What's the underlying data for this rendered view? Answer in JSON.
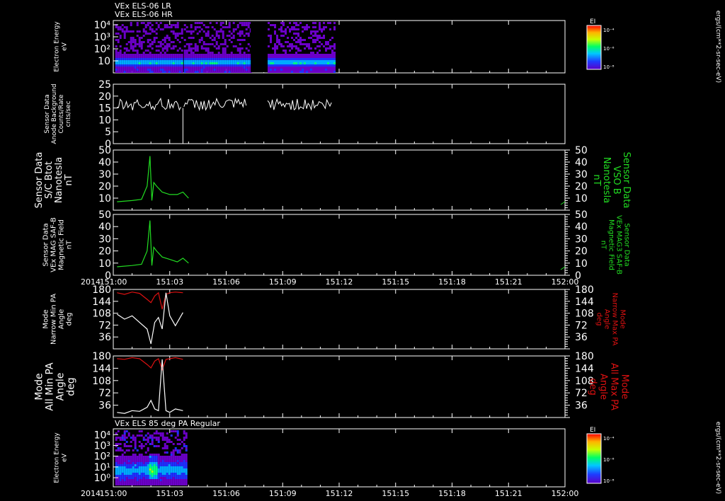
{
  "colors": {
    "background": "#000000",
    "foreground": "#ffffff",
    "green": "#22dd22",
    "red": "#dd1111"
  },
  "header": {
    "line1": "VEx ELS-06 LR",
    "line2": "VEx ELS-06 HR"
  },
  "chart_data": [
    {
      "type": "heatmap",
      "name": "panel-1",
      "ylabel": [
        "Electron Energy",
        "eV"
      ],
      "ylog": true,
      "yticks": [
        "10",
        "10²",
        "10³",
        "10⁴"
      ],
      "colorbar": {
        "title": "EI",
        "ticks": [
          "10⁻⁴",
          "10⁻⁶",
          "10⁻⁸"
        ],
        "unit_label": "ergs/(cm**2-sr-sec-eV)"
      },
      "data_segments": [
        [
          "151:00.1",
          "151:03.6"
        ],
        [
          "151:03.75",
          "151:07.3"
        ],
        [
          "151:08.2",
          "151:11.8"
        ]
      ],
      "gap": [
        "151:07.3",
        "151:08.2"
      ]
    },
    {
      "type": "line",
      "name": "panel-2",
      "ylabel": [
        "Sensor Data",
        "Anode Background",
        "Counts/Rate",
        "cnts/sec"
      ],
      "ylim": [
        0,
        25
      ],
      "yticks": [
        "0",
        "5",
        "10",
        "15",
        "20",
        "25"
      ],
      "series": [
        {
          "color": "#ffffff",
          "level_mean": 16.5,
          "spread": 2.5,
          "dropout_at": "151:03.7"
        }
      ]
    },
    {
      "type": "line",
      "name": "panel-3",
      "ylabel": [
        "Sensor Data",
        "S/C Btot",
        "Nanotesla",
        "nT"
      ],
      "ylabel_right": [
        "Sensor Data",
        "VSO B",
        "Nanotesla",
        "nT"
      ],
      "ylim": [
        0,
        50
      ],
      "yticks": [
        "10",
        "20",
        "30",
        "40",
        "50"
      ],
      "series": [
        {
          "color": "#22dd22",
          "x": [
            "151:00.2",
            "151:01.0",
            "151:01.5",
            "151:01.8",
            "151:01.95",
            "151:02.05",
            "151:02.15",
            "151:02.3",
            "151:02.6",
            "151:03.0",
            "151:03.4",
            "151:03.7",
            "151:04.0"
          ],
          "y": [
            7,
            8,
            9,
            20,
            45,
            8,
            23,
            20,
            15,
            13,
            13,
            15,
            10
          ]
        }
      ]
    },
    {
      "type": "line",
      "name": "panel-4",
      "ylabel": [
        "Sensor Data",
        "VEx MAG SAF-B",
        "Magnetic Field",
        "nT"
      ],
      "ylabel_right": [
        "Sensor Data",
        "VEx MAG3 SAF-B",
        "Magnetic Field",
        "nT"
      ],
      "ylim": [
        0,
        50
      ],
      "yticks": [
        "0",
        "10",
        "20",
        "30",
        "40",
        "50"
      ],
      "series": [
        {
          "color": "#22dd22",
          "x": [
            "151:00.2",
            "151:01.0",
            "151:01.5",
            "151:01.8",
            "151:01.95",
            "151:02.05",
            "151:02.15",
            "151:02.3",
            "151:02.6",
            "151:03.0",
            "151:03.4",
            "151:03.7",
            "151:04.0"
          ],
          "y": [
            7,
            8,
            9,
            20,
            45,
            8,
            23,
            20,
            15,
            13,
            11,
            14,
            10
          ]
        }
      ]
    },
    {
      "type": "line",
      "name": "panel-5",
      "ylabel": [
        "Mode",
        "Narrow Min PA",
        "Angle",
        "deg"
      ],
      "ylabel_right": [
        "Mode",
        "Narrow Max PA",
        "Angle",
        "deg"
      ],
      "ylim": [
        0,
        180
      ],
      "yticks": [
        "36",
        "72",
        "108",
        "144",
        "180"
      ],
      "series": [
        {
          "color": "#dd1111",
          "x": [
            "151:00.2",
            "151:00.6",
            "151:01.0",
            "151:01.4",
            "151:01.8",
            "151:02.0",
            "151:02.2",
            "151:02.4",
            "151:02.6",
            "151:02.8",
            "151:03.0",
            "151:03.3",
            "151:03.7"
          ],
          "y": [
            170,
            165,
            172,
            168,
            150,
            140,
            160,
            170,
            120,
            165,
            170,
            172,
            170
          ]
        },
        {
          "color": "#ffffff",
          "x": [
            "151:00.2",
            "151:00.6",
            "151:01.0",
            "151:01.4",
            "151:01.8",
            "151:02.0",
            "151:02.2",
            "151:02.4",
            "151:02.6",
            "151:02.8",
            "151:03.0",
            "151:03.3",
            "151:03.7"
          ],
          "y": [
            105,
            90,
            100,
            80,
            60,
            15,
            80,
            95,
            60,
            170,
            100,
            70,
            110
          ]
        }
      ]
    },
    {
      "type": "line",
      "name": "panel-6",
      "ylabel": [
        "Mode",
        "All Min PA",
        "Angle",
        "deg"
      ],
      "ylabel_right": [
        "Mode",
        "All Max PA",
        "Angle",
        "deg"
      ],
      "ylim": [
        0,
        180
      ],
      "yticks": [
        "36",
        "72",
        "108",
        "144",
        "180"
      ],
      "series": [
        {
          "color": "#dd1111",
          "x": [
            "151:00.2",
            "151:00.6",
            "151:01.0",
            "151:01.4",
            "151:01.8",
            "151:02.0",
            "151:02.2",
            "151:02.4",
            "151:02.6",
            "151:02.8",
            "151:03.0",
            "151:03.3",
            "151:03.7"
          ],
          "y": [
            172,
            170,
            175,
            172,
            155,
            145,
            165,
            172,
            140,
            170,
            172,
            175,
            170
          ]
        },
        {
          "color": "#ffffff",
          "x": [
            "151:00.2",
            "151:00.6",
            "151:01.0",
            "151:01.4",
            "151:01.8",
            "151:02.0",
            "151:02.2",
            "151:02.4",
            "151:02.6",
            "151:02.8",
            "151:03.0",
            "151:03.3",
            "151:03.7"
          ],
          "y": [
            15,
            12,
            20,
            18,
            30,
            50,
            25,
            20,
            170,
            20,
            15,
            25,
            20
          ]
        }
      ]
    },
    {
      "type": "heatmap",
      "name": "panel-7",
      "title": "VEx ELS 85 deg PA Regular",
      "ylabel": [
        "Electron Energy",
        "eV"
      ],
      "ylog": true,
      "yticks": [
        "10⁰",
        "10¹",
        "10²",
        "10³",
        "10⁴"
      ],
      "colorbar": {
        "title": "EI",
        "ticks": [
          "10⁻⁴",
          "10⁻⁶",
          "10⁻⁸"
        ],
        "unit_label": "ergs/(cm**2-sr-sec-eV)"
      },
      "data_segments": [
        [
          "151:00.1",
          "151:03.9"
        ]
      ]
    }
  ],
  "x_axis": {
    "year": "2014",
    "ticks": [
      "151:00",
      "151:03",
      "151:06",
      "151:09",
      "151:12",
      "151:15",
      "151:18",
      "151:21",
      "152:00"
    ],
    "range_minutes": [
      0,
      24
    ]
  }
}
